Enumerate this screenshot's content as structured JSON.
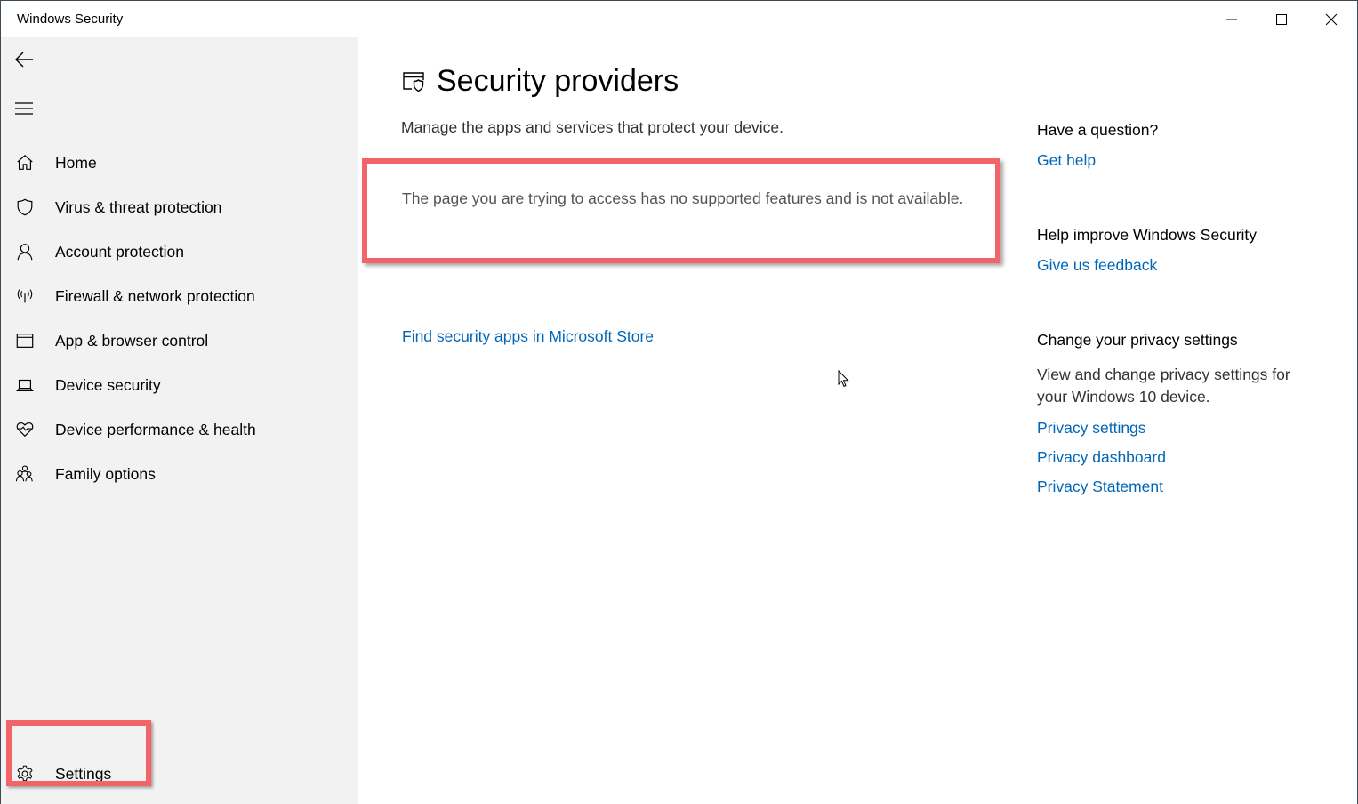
{
  "window": {
    "title": "Windows Security",
    "controls": {
      "minimize": "minimize-icon",
      "maximize": "maximize-icon",
      "close": "close-icon"
    }
  },
  "sidebar": {
    "back_icon": "back-arrow-icon",
    "menu_icon": "hamburger-menu-icon",
    "items": [
      {
        "label": "Home",
        "icon": "home-icon"
      },
      {
        "label": "Virus & threat protection",
        "icon": "shield-icon"
      },
      {
        "label": "Account protection",
        "icon": "person-icon"
      },
      {
        "label": "Firewall & network protection",
        "icon": "antenna-icon"
      },
      {
        "label": "App & browser control",
        "icon": "browser-window-icon"
      },
      {
        "label": "Device security",
        "icon": "laptop-icon"
      },
      {
        "label": "Device performance & health",
        "icon": "heart-pulse-icon"
      },
      {
        "label": "Family options",
        "icon": "family-icon"
      }
    ],
    "settings": {
      "label": "Settings",
      "icon": "gear-icon"
    }
  },
  "main": {
    "title_icon": "security-providers-icon",
    "title": "Security providers",
    "subtitle": "Manage the apps and services that protect your device.",
    "message": "The page you are trying to access has no supported features and is not available.",
    "store_link": "Find security apps in Microsoft Store"
  },
  "right_pane": {
    "question_heading": "Have a question?",
    "get_help": "Get help",
    "improve_heading": "Help improve Windows Security",
    "feedback": "Give us feedback",
    "privacy_heading": "Change your privacy settings",
    "privacy_text": "View and change privacy settings for your Windows 10 device.",
    "privacy_links": [
      "Privacy settings",
      "Privacy dashboard",
      "Privacy Statement"
    ]
  },
  "colors": {
    "link": "#0067b8",
    "sidebar_bg": "#f2f2f2",
    "highlight": "#f26467"
  }
}
